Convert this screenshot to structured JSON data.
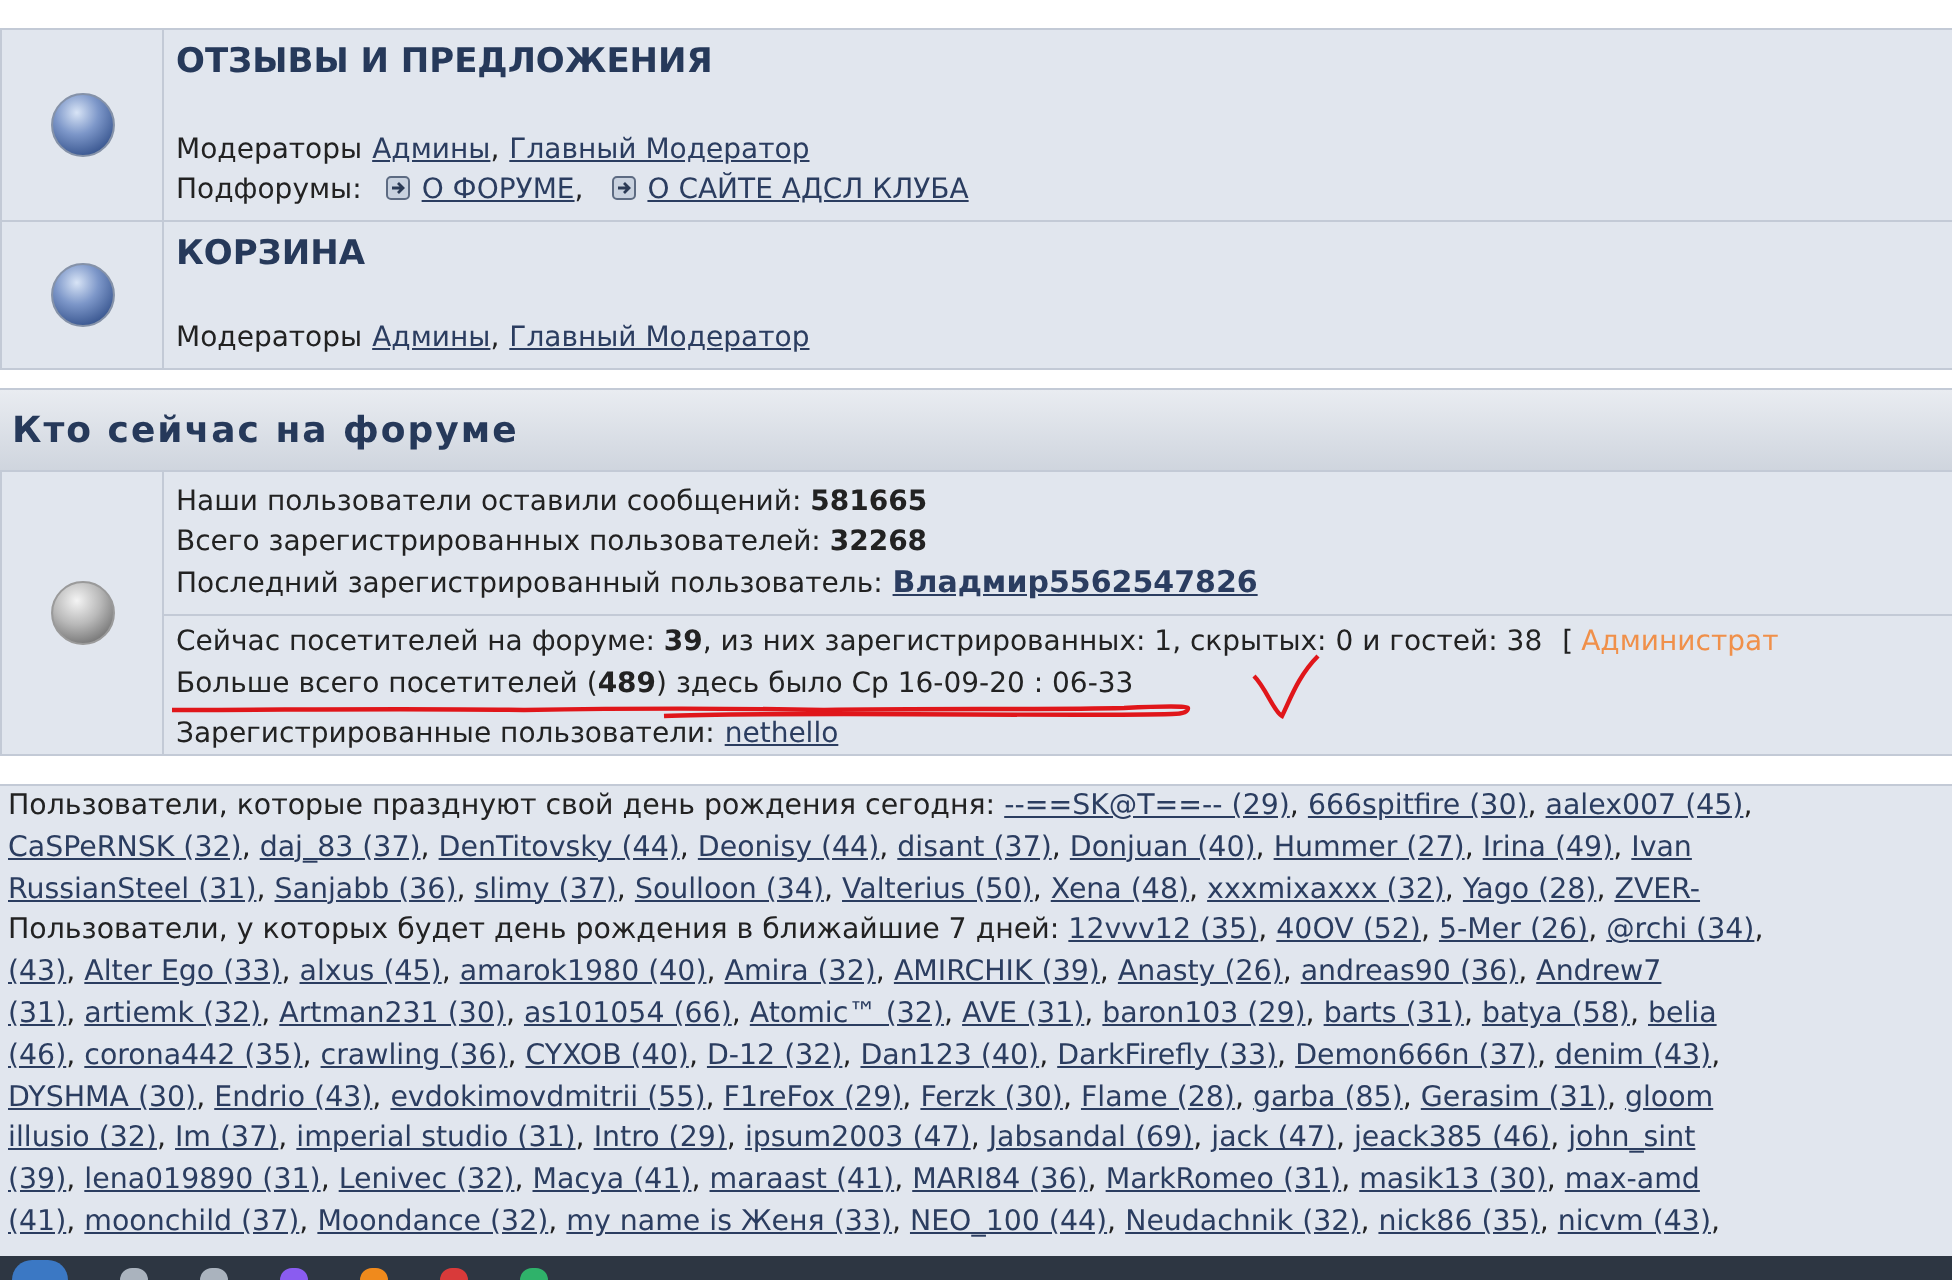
{
  "forums": [
    {
      "title": "ОТЗЫВЫ И ПРЕДЛОЖЕНИЯ",
      "moderators_label": "Модераторы",
      "moderators": [
        {
          "name": "Админы",
          "sep": ","
        },
        {
          "name": "Главный Модератор"
        }
      ],
      "subforums_label": "Подфорумы:",
      "subforums": [
        {
          "name": "О ФОРУМЕ",
          "sep": ","
        },
        {
          "name": "О САЙТЕ АДСЛ КЛУБА"
        }
      ]
    },
    {
      "title": "КОРЗИНА",
      "moderators_label": "Модераторы",
      "moderators": [
        {
          "name": "Админы",
          "sep": ","
        },
        {
          "name": "Главный Модератор"
        }
      ]
    }
  ],
  "who_online": {
    "title": "Кто сейчас на форуме",
    "stats": [
      "Наши пользователи оставили сообщений: **581665**",
      "Всего зарегистрированных пользователей: **32268**"
    ],
    "last_user": {
      "label": "Последний зарегистрированный пользователь:",
      "name": "Владмир5562547826"
    },
    "online": {
      "text": "Сейчас посетителей на форуме: **39**, из них зарегистрированных: 1, скрытых: 0 и гостей: 38",
      "bracket": "[",
      "admin_link": "Администрат"
    },
    "record": "Больше всего посетителей (**489**) здесь было Ср 16-09-20 : 06-33",
    "registered": {
      "label": "Зарегистрированные пользователи:",
      "user": "nethello"
    }
  },
  "birthday_lines": [
    {
      "lead": "Пользователи, которые празднуют свой день рождения сегодня: ",
      "users": [
        {
          "name": "--==SK@T==-- (29)",
          "after": ", "
        },
        {
          "name": "666spitfire (30)",
          "after": ", "
        },
        {
          "name": "aalex007 (45)",
          "after": ","
        }
      ]
    },
    {
      "users": [
        {
          "name": "CaSPeRNSK (32)",
          "after": ", "
        },
        {
          "name": "daj_83 (37)",
          "after": ", "
        },
        {
          "name": "DenTitovsky (44)",
          "after": ", "
        },
        {
          "name": "Deonisy (44)",
          "after": ", "
        },
        {
          "name": "disant (37)",
          "after": ", "
        },
        {
          "name": "Donjuan (40)",
          "after": ", "
        },
        {
          "name": "Hummer (27)",
          "after": ", "
        },
        {
          "name": "Irina (49)",
          "after": ", "
        },
        {
          "name": "Ivan"
        }
      ]
    },
    {
      "users": [
        {
          "name": "RussianSteel (31)",
          "after": ", "
        },
        {
          "name": "Sanjabb (36)",
          "after": ", "
        },
        {
          "name": "slimy (37)",
          "after": ", "
        },
        {
          "name": "Soulloon (34)",
          "after": ", "
        },
        {
          "name": "Valterius (50)",
          "after": ", "
        },
        {
          "name": "Xena (48)",
          "after": ", "
        },
        {
          "name": "xxxmixaxxx (32)",
          "after": ", "
        },
        {
          "name": "Yago (28)",
          "after": ", "
        },
        {
          "name": "ZVER-"
        }
      ]
    },
    {
      "lead": "Пользователи, у которых будет день рождения в ближайшие 7 дней: ",
      "users": [
        {
          "name": "12vvv12 (35)",
          "after": ", "
        },
        {
          "name": "40OV (52)",
          "after": ", "
        },
        {
          "name": "5-Mer (26)",
          "after": ", "
        },
        {
          "name": "@rchi (34)",
          "after": ","
        }
      ]
    },
    {
      "users": [
        {
          "name": "(43)",
          "after": ", "
        },
        {
          "name": "Alter Ego (33)",
          "after": ", "
        },
        {
          "name": "alxus (45)",
          "after": ", "
        },
        {
          "name": "amarok1980 (40)",
          "after": ", "
        },
        {
          "name": "Amira (32)",
          "after": ", "
        },
        {
          "name": "AMIRCHIK   (39)",
          "after": ", "
        },
        {
          "name": "Anasty (26)",
          "after": ", "
        },
        {
          "name": "andreas90 (36)",
          "after": ", "
        },
        {
          "name": "Andrew7"
        }
      ]
    },
    {
      "users": [
        {
          "name": "(31)",
          "after": ", "
        },
        {
          "name": "artiemk (32)",
          "after": ", "
        },
        {
          "name": "Artman231 (30)",
          "after": ", "
        },
        {
          "name": "as101054 (66)",
          "after": ", "
        },
        {
          "name": "Atomic™ (32)",
          "after": ", "
        },
        {
          "name": "AVE (31)",
          "after": ", "
        },
        {
          "name": "baron103 (29)",
          "after": ", "
        },
        {
          "name": "barts (31)",
          "after": ", "
        },
        {
          "name": "batya (58)",
          "after": ", "
        },
        {
          "name": "belia"
        }
      ]
    },
    {
      "users": [
        {
          "name": "(46)",
          "after": ", "
        },
        {
          "name": "corona442 (35)",
          "after": ", "
        },
        {
          "name": "crawling (36)",
          "after": ", "
        },
        {
          "name": "CYXOB (40)",
          "after": ", "
        },
        {
          "name": "D-12 (32)",
          "after": ", "
        },
        {
          "name": "Dan123 (40)",
          "after": ", "
        },
        {
          "name": "DarkFirefly (33)",
          "after": ", "
        },
        {
          "name": "Demon666n (37)",
          "after": ", "
        },
        {
          "name": "denim (43)",
          "after": ","
        }
      ]
    },
    {
      "users": [
        {
          "name": "DYSHMA (30)",
          "after": ", "
        },
        {
          "name": "Endrio (43)",
          "after": ", "
        },
        {
          "name": "evdokimovdmitrii (55)",
          "after": ", "
        },
        {
          "name": "F1reFox (29)",
          "after": ", "
        },
        {
          "name": "Ferzk (30)",
          "after": ", "
        },
        {
          "name": "Flame (28)",
          "after": ", "
        },
        {
          "name": "garba (85)",
          "after": ", "
        },
        {
          "name": "Gerasim (31)",
          "after": ", "
        },
        {
          "name": "gloom"
        }
      ]
    },
    {
      "users": [
        {
          "name": "illusio (32)",
          "after": ", "
        },
        {
          "name": "Im (37)",
          "after": ", "
        },
        {
          "name": "imperial studio (31)",
          "after": ", "
        },
        {
          "name": "Intro (29)",
          "after": ", "
        },
        {
          "name": "ipsum2003 (47)",
          "after": ", "
        },
        {
          "name": "Jabsandal (69)",
          "after": ", "
        },
        {
          "name": "jack (47)",
          "after": ", "
        },
        {
          "name": "jeack385 (46)",
          "after": ", "
        },
        {
          "name": "john_sint"
        }
      ]
    },
    {
      "users": [
        {
          "name": "(39)",
          "after": ", "
        },
        {
          "name": "lena019890 (31)",
          "after": ", "
        },
        {
          "name": "Lenivec (32)",
          "after": ", "
        },
        {
          "name": "Macya (41)",
          "after": ", "
        },
        {
          "name": "maraast (41)",
          "after": ", "
        },
        {
          "name": "MARI84 (36)",
          "after": ", "
        },
        {
          "name": "MarkRomeo (31)",
          "after": ", "
        },
        {
          "name": "masik13 (30)",
          "after": ", "
        },
        {
          "name": "max-amd"
        }
      ]
    },
    {
      "users": [
        {
          "name": "(41)",
          "after": ", "
        },
        {
          "name": "moonchild (37)",
          "after": ", "
        },
        {
          "name": "Moondance (32)",
          "after": ", "
        },
        {
          "name": "my name is Женя (33)",
          "after": ", "
        },
        {
          "name": "NEO_100 (44)",
          "after": ", "
        },
        {
          "name": "Neudachnik (32)",
          "after": ", "
        },
        {
          "name": "nick86 (35)",
          "after": ", "
        },
        {
          "name": "nicvm (43)",
          "after": ","
        }
      ]
    }
  ]
}
